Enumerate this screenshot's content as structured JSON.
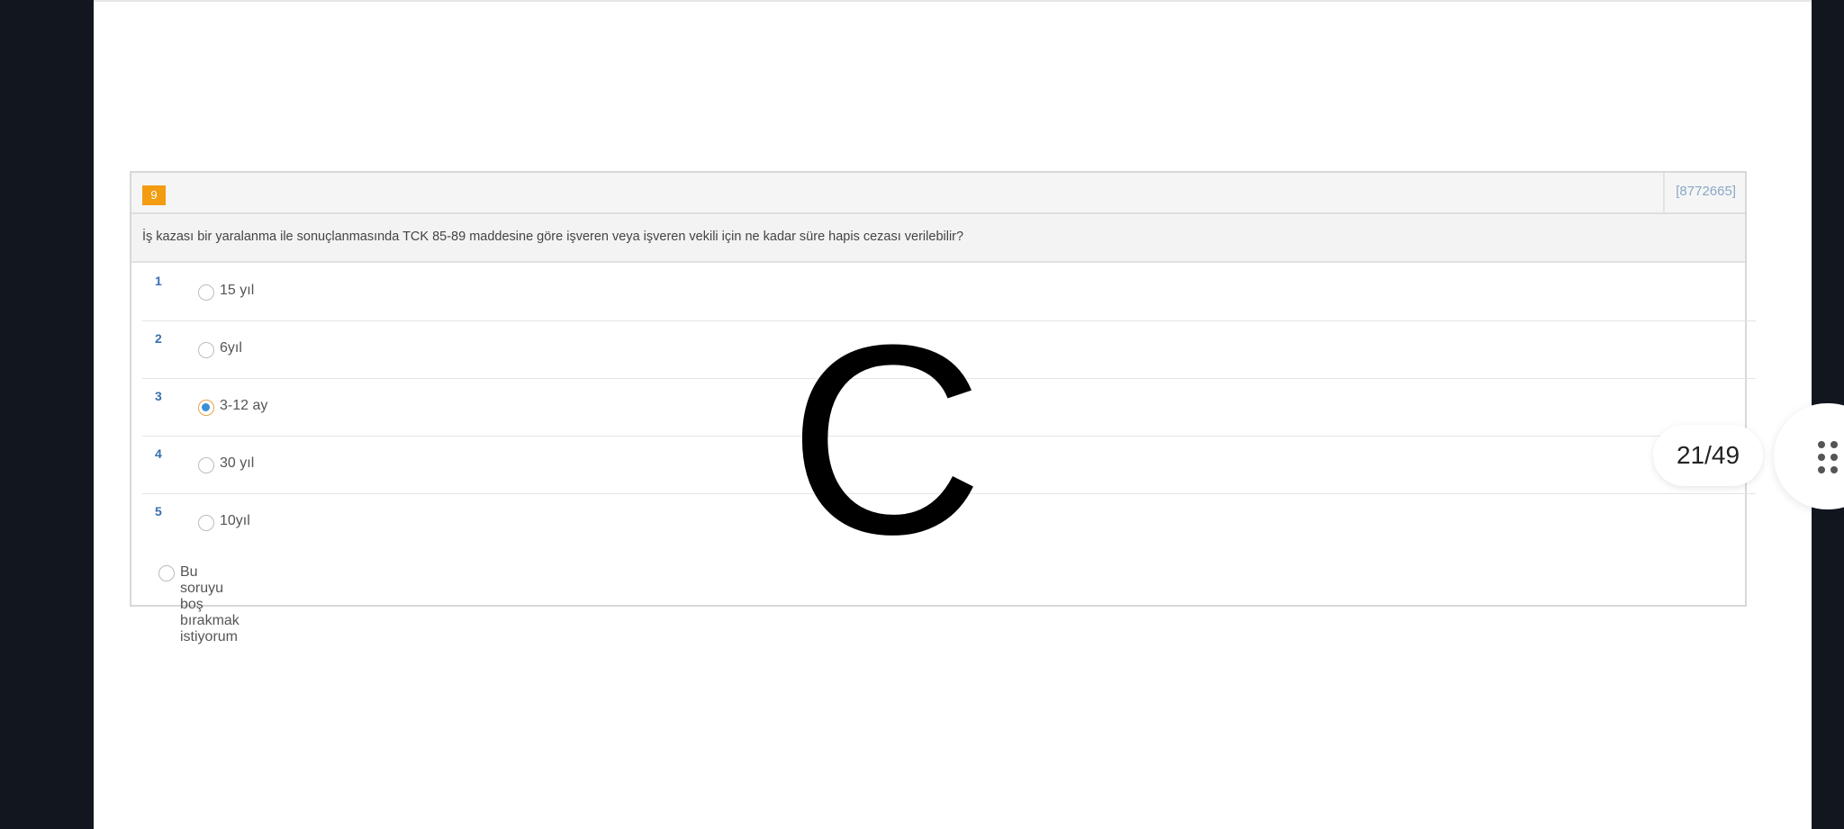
{
  "question": {
    "number": "9",
    "code": "[8772665]",
    "text": "İş kazası bir yaralanma ile sonuçlanmasında TCK 85-89 maddesine göre işveren veya işveren vekili için ne kadar süre hapis cezası verilebilir?",
    "options": [
      {
        "num": "1",
        "label": "15 yıl",
        "selected": false
      },
      {
        "num": "2",
        "label": "6yıl",
        "selected": false
      },
      {
        "num": "3",
        "label": "3-12 ay",
        "selected": true
      },
      {
        "num": "4",
        "label": "30 yıl",
        "selected": false
      },
      {
        "num": "5",
        "label": "10yıl",
        "selected": false
      }
    ],
    "skip_label": "Bu soruyu boş bırakmak istiyorum"
  },
  "overlay_letter": "C",
  "page_counter": "21/49",
  "colors": {
    "question_badge": "#f39c12",
    "option_number": "#3a6fb0",
    "selected_radio_dot": "#3b8fd6",
    "background_dark": "#12161f"
  },
  "icons": {
    "menu": "grid-dots-icon"
  }
}
